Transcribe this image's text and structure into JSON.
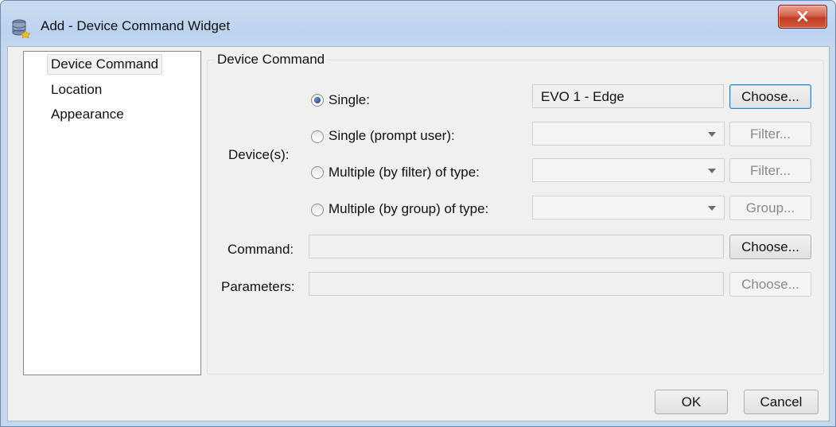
{
  "window": {
    "title": "Add - Device Command Widget"
  },
  "nav": {
    "items": [
      {
        "label": "Device Command",
        "selected": true
      },
      {
        "label": "Location"
      },
      {
        "label": "Appearance"
      }
    ]
  },
  "group": {
    "title": "Device Command"
  },
  "devices": {
    "label": "Device(s):",
    "options": [
      {
        "label": "Single:",
        "checked": true,
        "value": "EVO 1 - Edge",
        "button": "Choose..."
      },
      {
        "label": "Single (prompt user):",
        "checked": false,
        "value": "",
        "button": "Filter..."
      },
      {
        "label": "Multiple (by filter) of type:",
        "checked": false,
        "value": "",
        "button": "Filter..."
      },
      {
        "label": "Multiple (by group) of type:",
        "checked": false,
        "value": "",
        "button": "Group..."
      }
    ]
  },
  "command": {
    "label": "Command:",
    "value": "",
    "button": "Choose..."
  },
  "parameters": {
    "label": "Parameters:",
    "value": "",
    "button": "Choose..."
  },
  "footer": {
    "ok": "OK",
    "cancel": "Cancel"
  }
}
